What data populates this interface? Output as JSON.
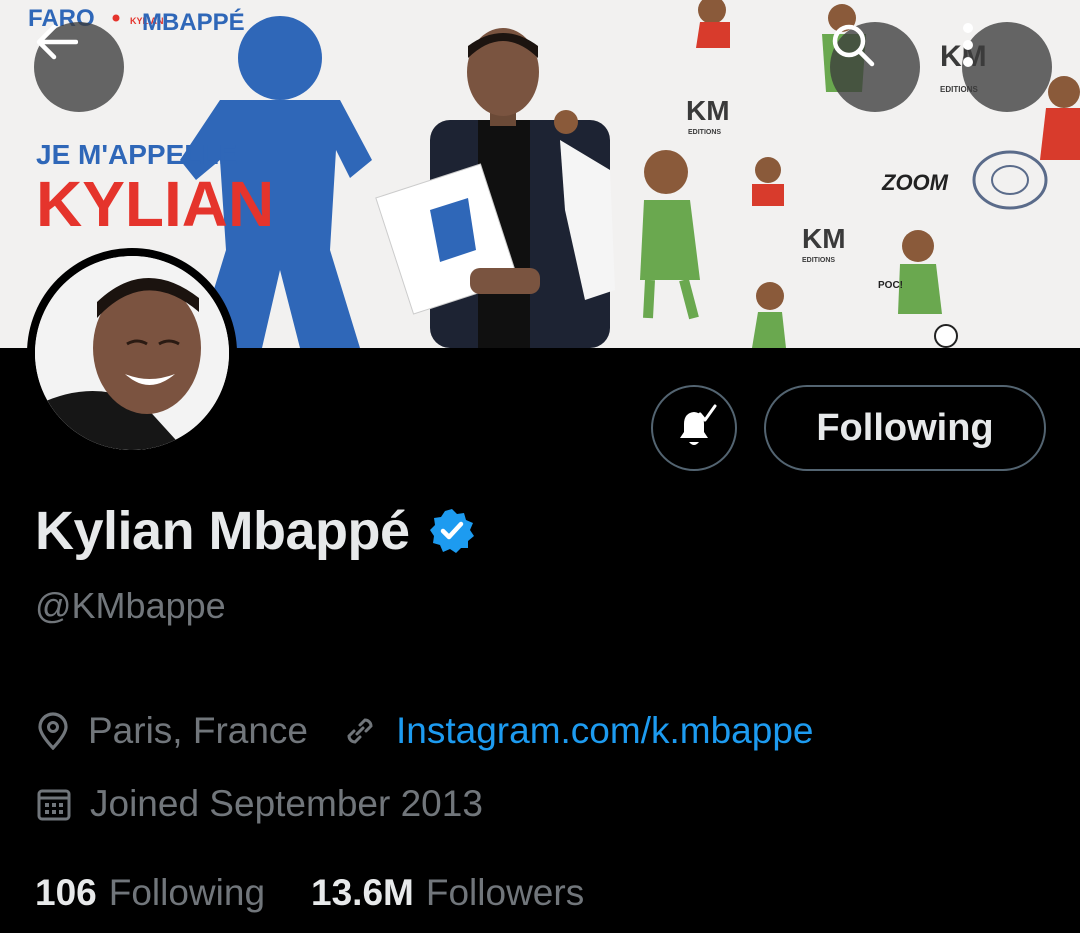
{
  "banner": {
    "brand_left": "FARO",
    "brand_small": "KYLIAN",
    "brand_right": "MBAPPÉ",
    "title_line1": "JE M'APPELLE",
    "title_line2": "KYLIAN",
    "km_logo": "KM",
    "km_sub": "EDITIONS",
    "zoom_text": "ZOOM",
    "poc_text": "POC!"
  },
  "header": {
    "back_icon": "arrow-left-icon",
    "search_icon": "search-icon",
    "more_icon": "more-vertical-icon"
  },
  "actions": {
    "notify_icon": "bell-check-icon",
    "following_label": "Following"
  },
  "profile": {
    "display_name": "Kylian Mbappé",
    "verified_icon": "verified-badge-icon",
    "handle": "@KMbappe",
    "location": "Paris, France",
    "link": "Instagram.com/k.mbappe",
    "joined": "Joined September 2013"
  },
  "stats": {
    "following_count": "106",
    "following_label": "Following",
    "followers_count": "13.6M",
    "followers_label": "Followers"
  },
  "colors": {
    "background": "#000000",
    "primary_text": "#e7e9ea",
    "secondary_text": "#71767b",
    "accent": "#1d9bf0",
    "border": "#536471"
  }
}
